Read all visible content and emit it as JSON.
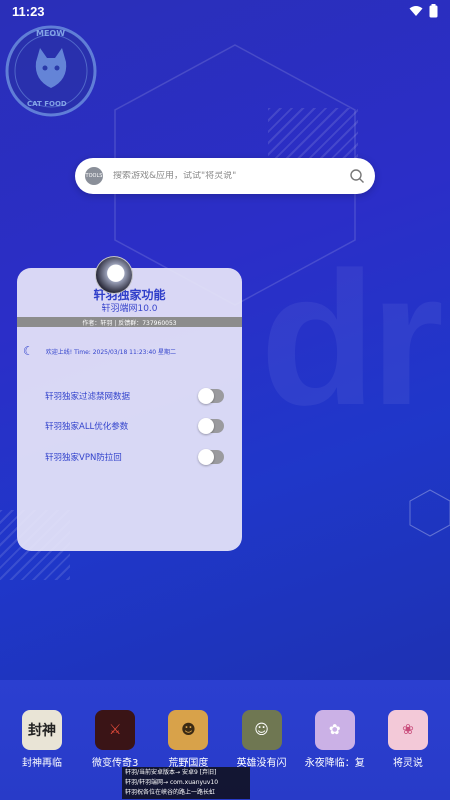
{
  "status": {
    "time": "11:23"
  },
  "logo": {
    "top_text": "MEOW",
    "bottom_text": "CAT FOOD"
  },
  "search": {
    "icon_label": "TOOLS",
    "placeholder": "搜索游戏&应用，试试\"将灵说\""
  },
  "panel": {
    "title": "轩羽独家功能",
    "subtitle": "轩羽端网10.0",
    "author_line": "作者：轩羽 | 反馈群：737960053",
    "online_line": "欢迎上线! Time: 2025/03/18 11:23:40 星期二",
    "toggles": [
      {
        "label": "轩羽独家过滤禁网数据",
        "on": false
      },
      {
        "label": "轩羽独家ALL优化参数",
        "on": false
      },
      {
        "label": "轩羽独家VPN防拉回",
        "on": false
      }
    ]
  },
  "apps": [
    {
      "label": "封神再临",
      "icon_text": "封神",
      "bg": "#e9e4d6",
      "fg": "#222"
    },
    {
      "label": "微变传奇3",
      "icon_text": "⚔",
      "bg": "#3a1416",
      "fg": "#e24b3b"
    },
    {
      "label": "荒野国度",
      "icon_text": "☻",
      "bg": "#d8a24a",
      "fg": "#3a2a14"
    },
    {
      "label": "英雄没有闪",
      "icon_text": "☺",
      "bg": "#6f7752",
      "fg": "#fff"
    },
    {
      "label": "永夜降临：复",
      "icon_text": "✿",
      "bg": "#cbb1e6",
      "fg": "#fff"
    },
    {
      "label": "将灵说",
      "icon_text": "❀",
      "bg": "#f3c9d8",
      "fg": "#c84a7a"
    }
  ],
  "toast": [
    "轩羽/当前安卓版本→ 安卓9 [弃旧]",
    "轩羽/轩羽端网→ com.xuanyuv10",
    "轩羽祝各位在峡谷的路上一路长虹"
  ],
  "colors": {
    "panel_text": "#2f3ec9",
    "background": "#2a2fb8"
  }
}
